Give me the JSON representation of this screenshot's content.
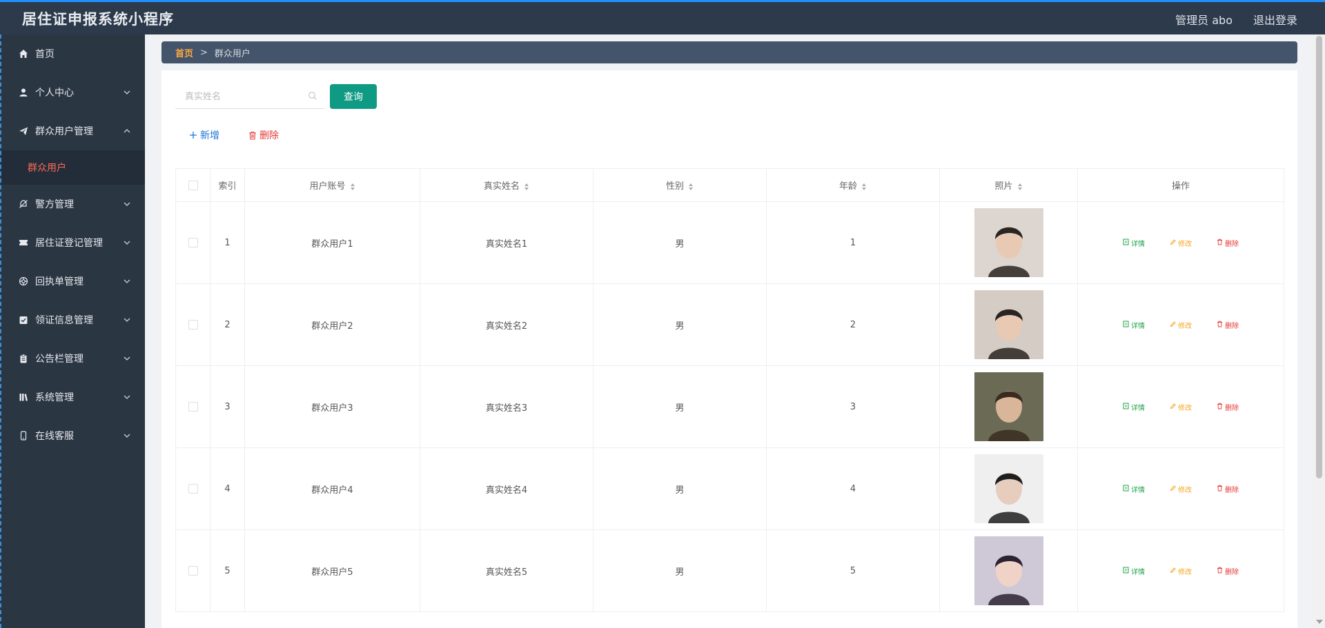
{
  "app": {
    "title": "居住证申报系统小程序",
    "admin_label": "管理员 abo",
    "logout_label": "退出登录"
  },
  "sidebar": {
    "items": [
      {
        "label": "首页",
        "icon": "home-icon",
        "expandable": false
      },
      {
        "label": "个人中心",
        "icon": "user-icon",
        "expandable": true
      },
      {
        "label": "群众用户管理",
        "icon": "send-icon",
        "expandable": true,
        "expanded": true
      },
      {
        "label": "警方管理",
        "icon": "bell-off-icon",
        "expandable": true
      },
      {
        "label": "居住证登记管理",
        "icon": "ticket-icon",
        "expandable": true
      },
      {
        "label": "回执单管理",
        "icon": "life-ring-icon",
        "expandable": true
      },
      {
        "label": "领证信息管理",
        "icon": "check-square-icon",
        "expandable": true
      },
      {
        "label": "公告栏管理",
        "icon": "clipboard-icon",
        "expandable": true
      },
      {
        "label": "系统管理",
        "icon": "library-icon",
        "expandable": true
      },
      {
        "label": "在线客服",
        "icon": "mobile-icon",
        "expandable": true
      }
    ],
    "active_sub": "群众用户"
  },
  "breadcrumb": {
    "home": "首页",
    "separator": ">",
    "current": "群众用户"
  },
  "search": {
    "placeholder": "真实姓名",
    "value": "",
    "query_label": "查询"
  },
  "actions": {
    "add_label": "新增",
    "delete_label": "删除"
  },
  "table": {
    "headers": {
      "index": "索引",
      "account": "用户账号",
      "realname": "真实姓名",
      "gender": "性别",
      "age": "年龄",
      "photo": "照片",
      "ops": "操作"
    },
    "rows": [
      {
        "index": "1",
        "account": "群众用户1",
        "realname": "真实姓名1",
        "gender": "男",
        "age": "1"
      },
      {
        "index": "2",
        "account": "群众用户2",
        "realname": "真实姓名2",
        "gender": "男",
        "age": "2"
      },
      {
        "index": "3",
        "account": "群众用户3",
        "realname": "真实姓名3",
        "gender": "男",
        "age": "3"
      },
      {
        "index": "4",
        "account": "群众用户4",
        "realname": "真实姓名4",
        "gender": "男",
        "age": "4"
      },
      {
        "index": "5",
        "account": "群众用户5",
        "realname": "真实姓名5",
        "gender": "男",
        "age": "5"
      }
    ],
    "ops": {
      "detail": "详情",
      "edit": "修改",
      "delete": "删除"
    }
  },
  "colors": {
    "topbar": "#2d3a4b",
    "sidebar": "#2b3643",
    "accent_green": "#0f9a84",
    "breadcrumb_home": "#ffa940",
    "active_sub": "#ff6a55"
  }
}
